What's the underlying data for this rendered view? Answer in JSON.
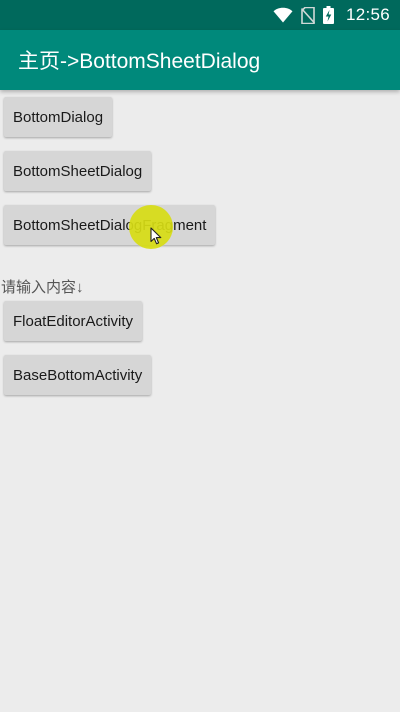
{
  "status_bar": {
    "time": "12:56",
    "icons": [
      "wifi-icon",
      "no-sim-icon",
      "battery-charging-icon"
    ],
    "background_color": "#00695c"
  },
  "app_bar": {
    "title": "主页->BottomSheetDialog",
    "background_color": "#00897b"
  },
  "buttons": [
    {
      "label": "BottomDialog"
    },
    {
      "label": "BottomSheetDialog"
    },
    {
      "label": "BottomSheetDialogFragment"
    },
    {
      "label": "FloatEditorActivity"
    },
    {
      "label": "BaseBottomActivity"
    }
  ],
  "hint": {
    "text": "请输入内容↓"
  },
  "touch_indicator": {
    "color": "#d7dc14"
  },
  "cursor": {
    "icon": "pointer-cursor-icon"
  }
}
